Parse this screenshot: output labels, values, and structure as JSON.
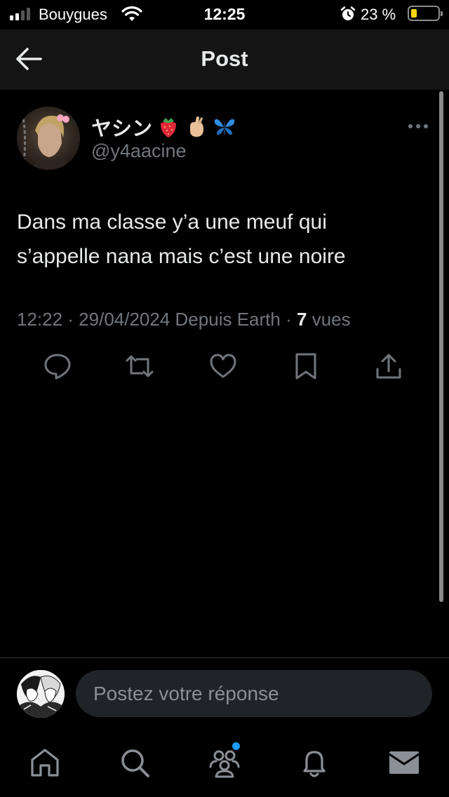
{
  "status_bar": {
    "carrier": "Bouygues",
    "time": "12:25",
    "battery_percent": "23 %",
    "battery_level": 0.23,
    "signal_bars": 2
  },
  "header": {
    "title": "Post",
    "back_icon": "arrow-left-icon"
  },
  "post": {
    "display_name": "ヤシン",
    "emojis": [
      "strawberry-emoji",
      "crossed-fingers-emoji",
      "butterfly-emoji"
    ],
    "handle": "@y4aacine",
    "text_line1": "Dans ma classe y’a une meuf qui",
    "text_line2": "s’appelle nana mais c’est une noire",
    "timestamp": "12:22 · 29/04/2024",
    "source": "Depuis Earth",
    "separator": "·",
    "views_count": "7",
    "views_label": "vues",
    "more_icon": "more-horizontal-icon"
  },
  "actions": [
    {
      "name": "reply-icon"
    },
    {
      "name": "repost-icon"
    },
    {
      "name": "like-icon"
    },
    {
      "name": "bookmark-icon"
    },
    {
      "name": "share-icon"
    }
  ],
  "reply_bar": {
    "placeholder": "Postez votre réponse"
  },
  "tab_bar": [
    {
      "name": "home-icon"
    },
    {
      "name": "search-icon"
    },
    {
      "name": "communities-icon",
      "has_badge": true
    },
    {
      "name": "notifications-icon"
    },
    {
      "name": "messages-icon"
    }
  ],
  "colors": {
    "background": "#000000",
    "header_background": "#141414",
    "text_primary": "#e7e9ea",
    "text_secondary": "#71767b",
    "accent": "#1d9bf0",
    "battery_low": "#ffd60a"
  }
}
